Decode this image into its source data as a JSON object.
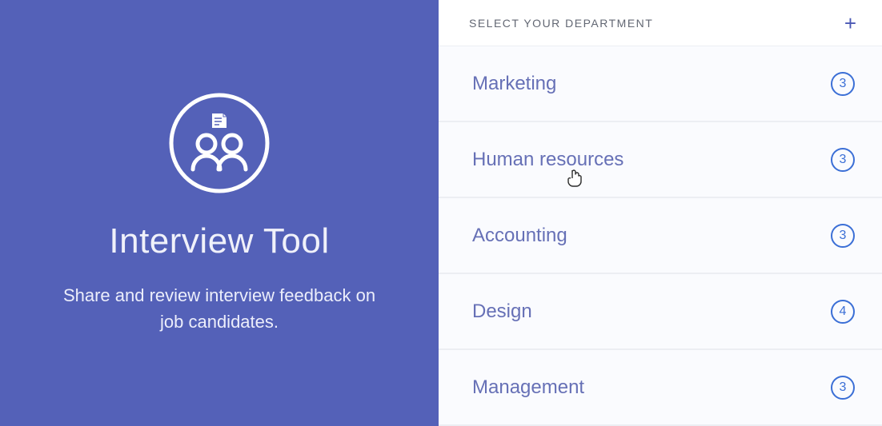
{
  "hero": {
    "title": "Interview Tool",
    "subtitle": "Share and review interview feedback on job candidates."
  },
  "header": {
    "label": "SELECT YOUR DEPARTMENT"
  },
  "departments": [
    {
      "name": "Marketing",
      "count": "3"
    },
    {
      "name": "Human resources",
      "count": "3"
    },
    {
      "name": "Accounting",
      "count": "3"
    },
    {
      "name": "Design",
      "count": "4"
    },
    {
      "name": "Management",
      "count": "3"
    }
  ],
  "colors": {
    "brand": "#5461b8",
    "accent": "#3b6fd6",
    "listText": "#6670b6"
  }
}
